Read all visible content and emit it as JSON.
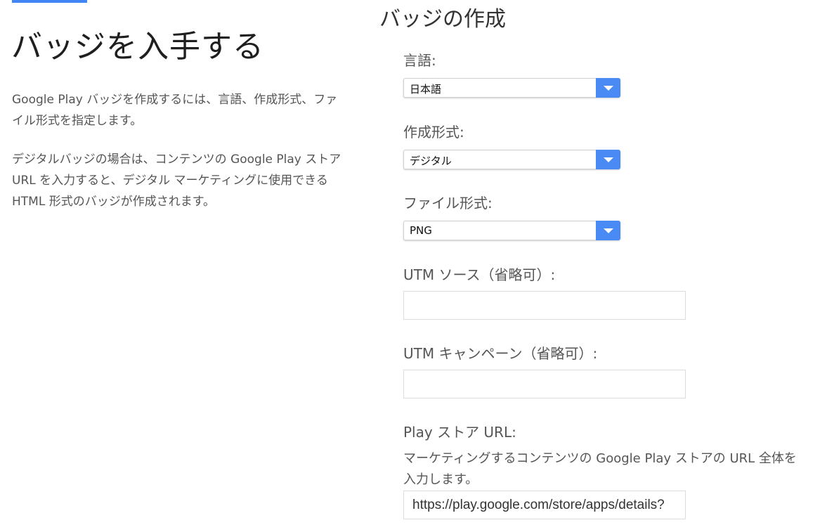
{
  "colors": {
    "accent": "#4285f4",
    "select_arrow_bg": "#4a8af4"
  },
  "page": {
    "title": "バッジを入手する",
    "intro_1": "Google Play バッジを作成するには、言語、作成形式、ファイル形式を指定します。",
    "intro_2": "デジタルバッジの場合は、コンテンツの Google Play ストア URL を入力すると、デジタル マーケティングに使用できる HTML 形式のバッジが作成されます。"
  },
  "form": {
    "title": "バッジの作成",
    "language": {
      "label": "言語:",
      "value": "日本語",
      "icon": "chevron-down-icon"
    },
    "format": {
      "label": "作成形式:",
      "value": "デジタル",
      "icon": "chevron-down-icon"
    },
    "file_type": {
      "label": "ファイル形式:",
      "value": "PNG",
      "icon": "chevron-down-icon"
    },
    "utm_source": {
      "label": "UTM ソース（省略可）:",
      "value": ""
    },
    "utm_campaign": {
      "label": "UTM キャンペーン（省略可）:",
      "value": ""
    },
    "play_url": {
      "label": "Play ストア URL:",
      "help": "マーケティングするコンテンツの Google Play ストアの URL 全体を入力します。",
      "value": "https://play.google.com/store/apps/details?"
    }
  }
}
